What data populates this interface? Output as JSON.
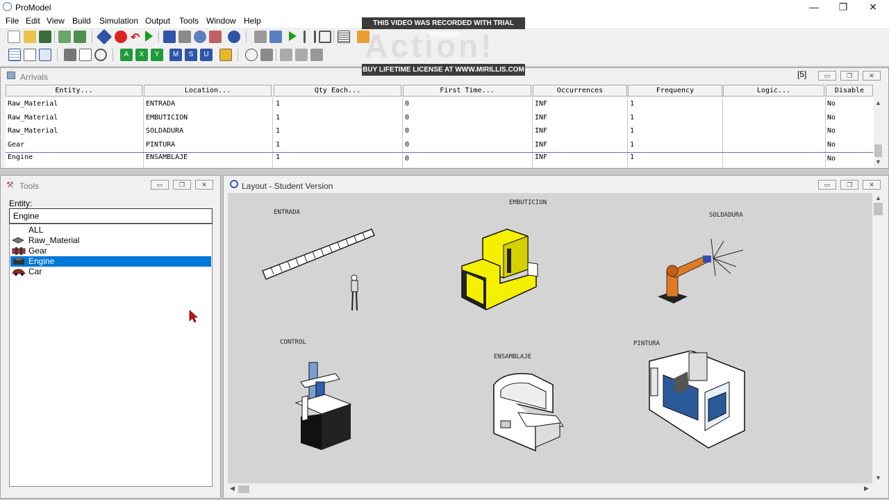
{
  "app": {
    "title": "ProModel"
  },
  "window_controls": {
    "minimize": "—",
    "restore": "❐",
    "close": "✕"
  },
  "menu": [
    "File",
    "Edit",
    "View",
    "Build",
    "Simulation",
    "Output",
    "Tools",
    "Window",
    "Help"
  ],
  "watermark": {
    "top": "THIS VIDEO WAS RECORDED WITH TRIAL VERSION",
    "logo": "Action!",
    "bottom": "BUY LIFETIME LICENSE AT WWW.MIRILLIS.COM"
  },
  "toolbar_icons": {
    "row1": [
      "new-icon",
      "open-icon",
      "save-icon",
      "print-icon",
      "print-preview-icon",
      "locations-icon",
      "stop-icon",
      "undo-icon",
      "run-icon",
      "entities-icon",
      "path-icon",
      "resources-icon",
      "processing-icon",
      "info-icon",
      "options-icon",
      "trace-icon",
      "animate-icon",
      "pause-icon",
      "step-icon",
      "view-text-icon",
      "graphics-icon"
    ],
    "row2": [
      "grid-icon",
      "routing-icon",
      "calc-icon",
      "tool-icon",
      "view-icon",
      "zoom-icon",
      "a-icon",
      "x-icon",
      "y-icon",
      "m-icon",
      "s-icon",
      "u-icon",
      "lock-icon",
      "layers-icon",
      "edit-icon",
      "move-back-icon",
      "move-fwd-icon",
      "delete-icon"
    ]
  },
  "arrivals": {
    "title": "Arrivals",
    "record_count": "[5]",
    "columns": [
      "Entity...",
      "Location...",
      "Qty Each...",
      "First Time...",
      "Occurrences",
      "Frequency",
      "Logic...",
      "Disable"
    ],
    "rows": [
      [
        "Raw_Material",
        "ENTRADA",
        "1",
        "0",
        "INF",
        "1",
        "",
        "No"
      ],
      [
        "Raw_Material",
        "EMBUTICION",
        "1",
        "0",
        "INF",
        "1",
        "",
        "No"
      ],
      [
        "Raw_Material",
        "SOLDADURA",
        "1",
        "0",
        "INF",
        "1",
        "",
        "No"
      ],
      [
        "Gear",
        "PINTURA",
        "1",
        "0",
        "INF",
        "1",
        "",
        "No"
      ],
      [
        "Engine",
        "ENSAMBLAJE",
        "1",
        "0",
        "INF",
        "1",
        "",
        "No"
      ]
    ]
  },
  "tools": {
    "title": "Tools",
    "entity_label": "Entity:",
    "entity_value": "Engine",
    "items": [
      {
        "label": "ALL",
        "icon": ""
      },
      {
        "label": "Raw_Material",
        "icon": "raw-material-icon"
      },
      {
        "label": "Gear",
        "icon": "gear-icon"
      },
      {
        "label": "Engine",
        "icon": "engine-icon"
      },
      {
        "label": "Car",
        "icon": "car-icon"
      }
    ],
    "selected": "Engine"
  },
  "layout": {
    "title": "Layout - Student Version",
    "locations": {
      "entrada": "ENTRADA",
      "embuticion": "EMBUTICION",
      "soldadura": "SOLDADURA",
      "control": "CONTROL",
      "ensamblaje": "ENSAMBLAJE",
      "pintura": "PINTURA"
    }
  },
  "colors": {
    "selection": "#0078d7",
    "machine_yellow": "#f5f000",
    "robot_orange": "#e07a20",
    "paint_blue": "#2a5a9a"
  }
}
